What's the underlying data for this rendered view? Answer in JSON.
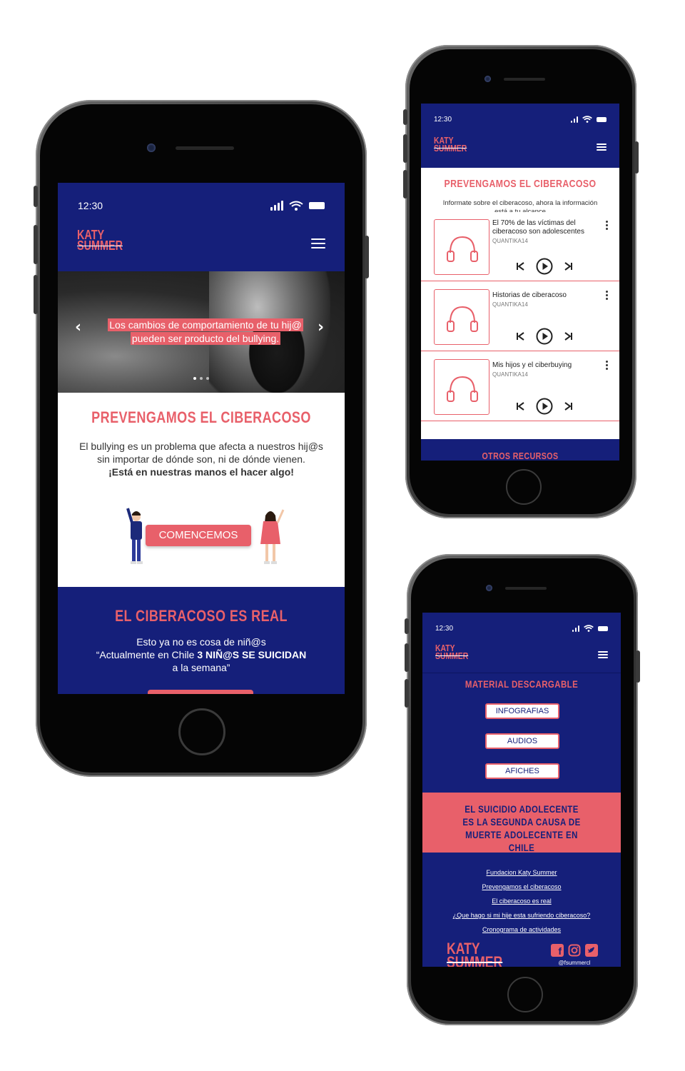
{
  "colors": {
    "navy": "#151f7a",
    "coral": "#e8606a",
    "white": "#ffffff"
  },
  "phone1": {
    "status_time": "12:30",
    "logo": {
      "line1": "KATY",
      "line2": "SUMMER"
    },
    "hero": {
      "caption": "Los cambios de comportamiento de tu hij@ pueden ser producto del bullying.",
      "prev_icon": "chevron-left-icon",
      "next_icon": "chevron-right-icon"
    },
    "section1": {
      "title": "PREVENGAMOS EL CIBERACOSO",
      "body": "El bullying es un problema que afecta a nuestros hij@s sin importar de dónde son, ni de dónde vienen.",
      "body_bold": "¡Está en nuestras manos el hacer algo!",
      "cta": "COMENCEMOS"
    },
    "section2": {
      "title": "EL CIBERACOSO ES REAL",
      "line1": "Esto ya no es cosa de niñ@s",
      "line2_prefix": "“Actualmente en Chile ",
      "line2_bold": "3 NIÑ@S SE SUICIDAN",
      "line3": "a la semana”"
    }
  },
  "phone2": {
    "status_time": "12:30",
    "logo": {
      "line1": "KATY",
      "line2": "SUMMER"
    },
    "title": "PREVENGAMOS EL CIBERACOSO",
    "subtitle": "Informate sobre el ciberacoso, ahora la información está a tu alcance",
    "audios": [
      {
        "title": "El 70% de las víctimas del ciberacoso son adolescentes",
        "author": "QUANTIKA14"
      },
      {
        "title": "Historias de ciberacoso",
        "author": "QUANTIKA14"
      },
      {
        "title": "Mis hijos y el ciberbuying",
        "author": "QUANTIKA14"
      }
    ],
    "bottom_title": "OTROS RECURSOS"
  },
  "phone3": {
    "status_time": "12:30",
    "logo": {
      "line1": "KATY",
      "line2": "SUMMER"
    },
    "title": "MATERIAL DESCARGABLE",
    "buttons": [
      "INFOGRAFIAS",
      "AUDIOS",
      "AFICHES"
    ],
    "banner": "EL SUICIDIO ADOLECENTE ES LA SEGUNDA CAUSA DE MUERTE ADOLECENTE EN CHILE",
    "links": [
      "Fundacion Katy Summer",
      "Prevengamos el ciberacoso",
      "El ciberacoso es real",
      "¿Que hago si mi hije esta sufriendo ciberacoso?",
      "Cronograma de actividades"
    ],
    "footer_logo": {
      "line1": "KATY",
      "line2": "SUMMER"
    },
    "social_icons": [
      "facebook-icon",
      "instagram-icon",
      "twitter-icon"
    ],
    "handle": "@fsummercl"
  }
}
